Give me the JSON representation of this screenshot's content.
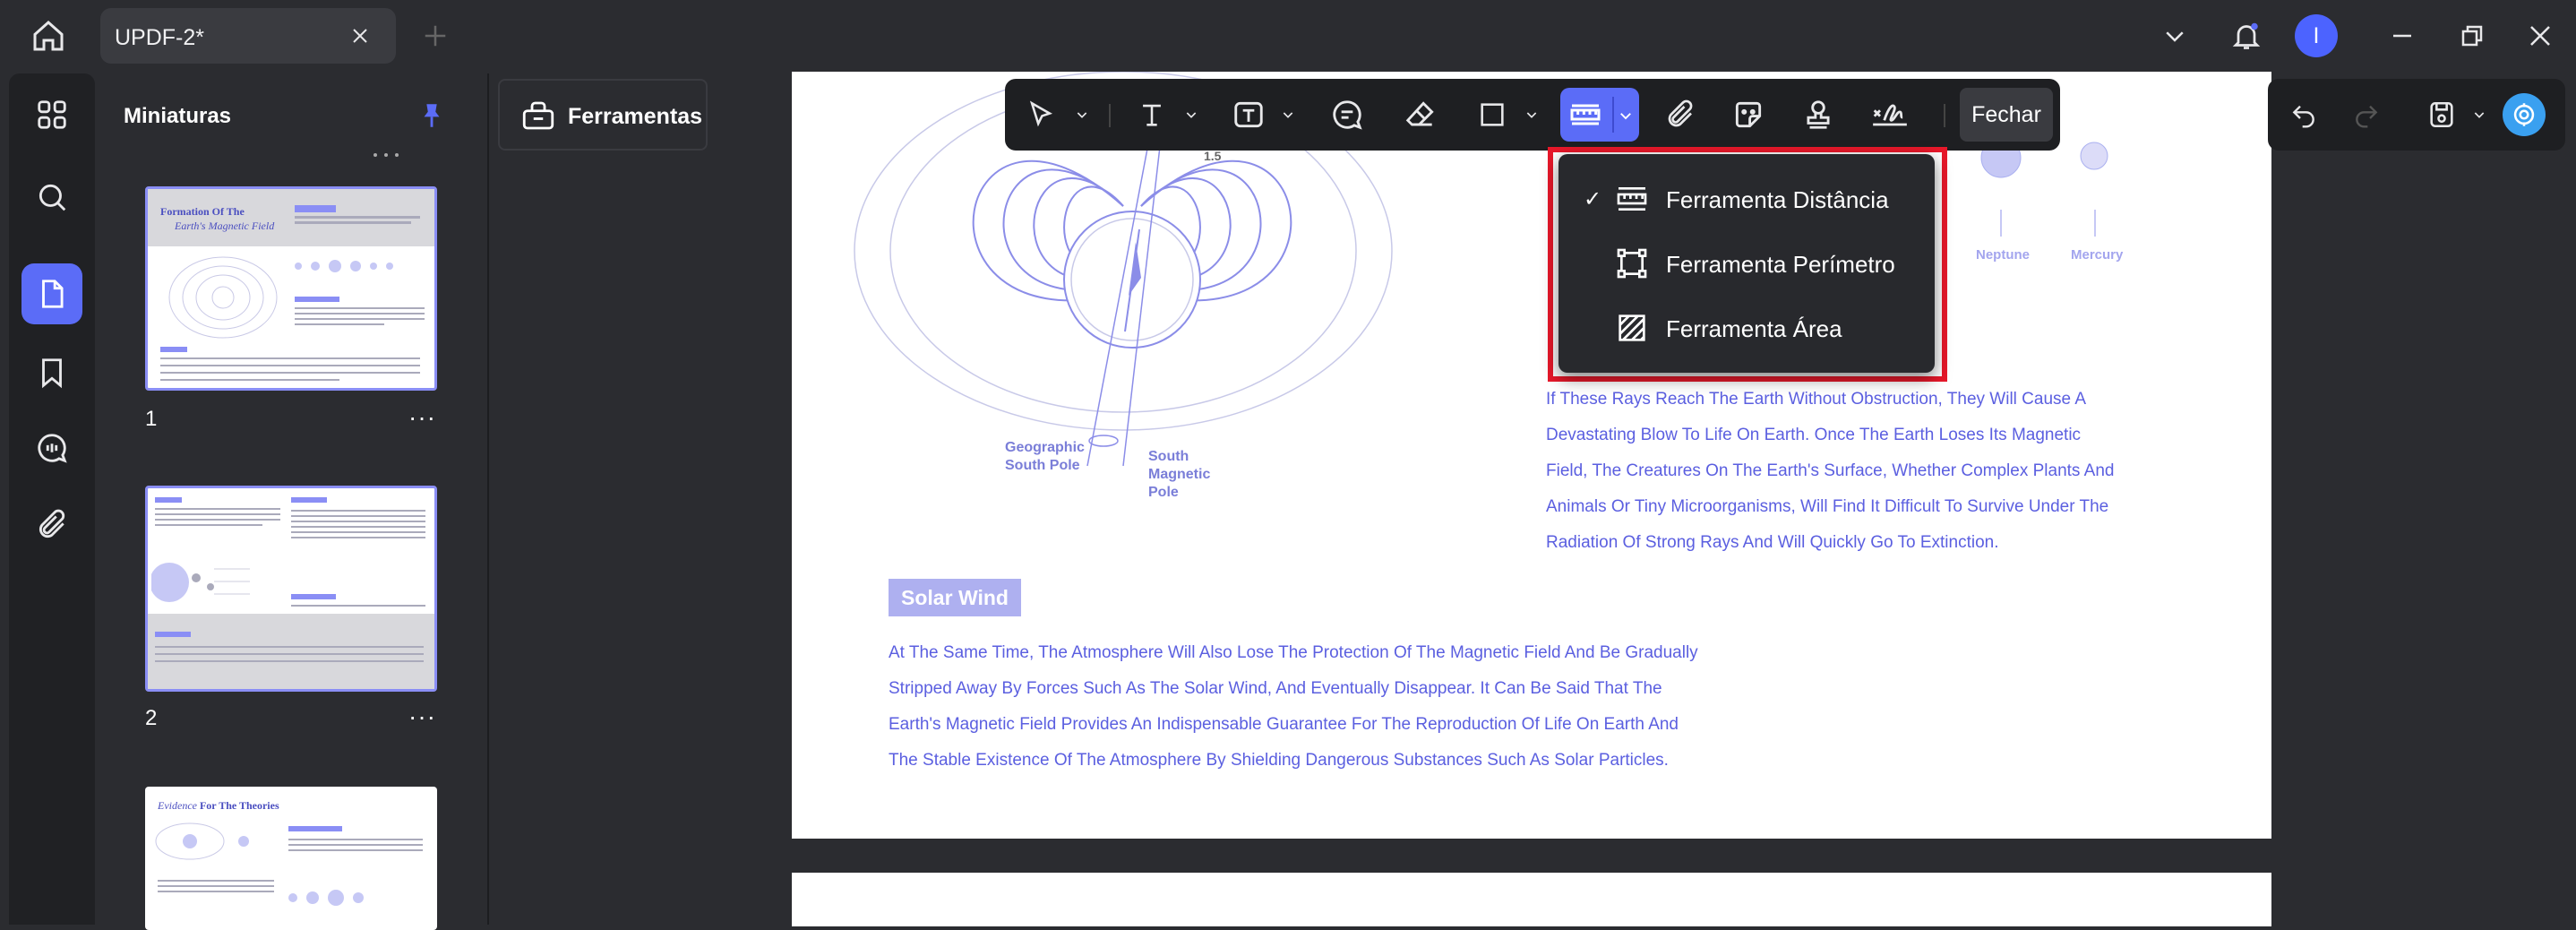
{
  "window": {
    "tab_title": "UPDF-2*"
  },
  "user": {
    "initial": "I"
  },
  "sidebar": {
    "panel_title": "Miniaturas",
    "pages": [
      {
        "number": "1",
        "more": "···"
      },
      {
        "number": "2",
        "more": "···"
      }
    ]
  },
  "tools_panel": {
    "label": "Ferramentas"
  },
  "toolbar": {
    "close_label": "Fechar"
  },
  "measure_menu": {
    "items": [
      {
        "label": "Ferramenta Distância",
        "checked": "✓",
        "icon": "ruler-icon"
      },
      {
        "label": "Ferramenta Perímetro",
        "icon": "perimeter-icon"
      },
      {
        "label": "Ferramenta Área",
        "icon": "area-icon"
      }
    ]
  },
  "thumbnails": {
    "page1_title_a": "Formation Of The",
    "page1_title_b": "Earth's Magnetic Field",
    "page3_title_a": "Evidence",
    "page3_title_b": "For The Theories"
  },
  "document": {
    "diagram_labels": {
      "angle": "1.5",
      "geo_south": "Geographic\nSouth Pole",
      "mag_south": "South\nMagnetic\nPole"
    },
    "planets": [
      "Neptune",
      "Mercury"
    ],
    "right_paragraph": [
      "If These Rays Reach The Earth Without Obstruction, They Will Cause A",
      "Devastating Blow To Life On Earth. Once The Earth Loses Its Magnetic",
      "Field, The Creatures On The Earth's Surface, Whether Complex Plants And",
      "Animals Or Tiny Microorganisms, Will Find It Difficult To Survive Under The",
      "Radiation Of Strong Rays And Will Quickly Go To Extinction."
    ],
    "section_badge": "Solar Wind",
    "body_paragraph": [
      "At The Same Time, The Atmosphere Will Also Lose The Protection Of The Magnetic Field And Be Gradually",
      "Stripped Away By Forces Such As The Solar Wind, And Eventually Disappear. It Can Be Said That The",
      "Earth's Magnetic Field Provides An Indispensable Guarantee For The Reproduction Of Life On Earth And",
      "The Stable Existence Of The Atmosphere By Shielding Dangerous Substances Such As Solar Particles."
    ]
  },
  "colors": {
    "accent": "#5b6cf7",
    "highlight": "#e8182a",
    "doc_text": "#5b5fe0"
  }
}
